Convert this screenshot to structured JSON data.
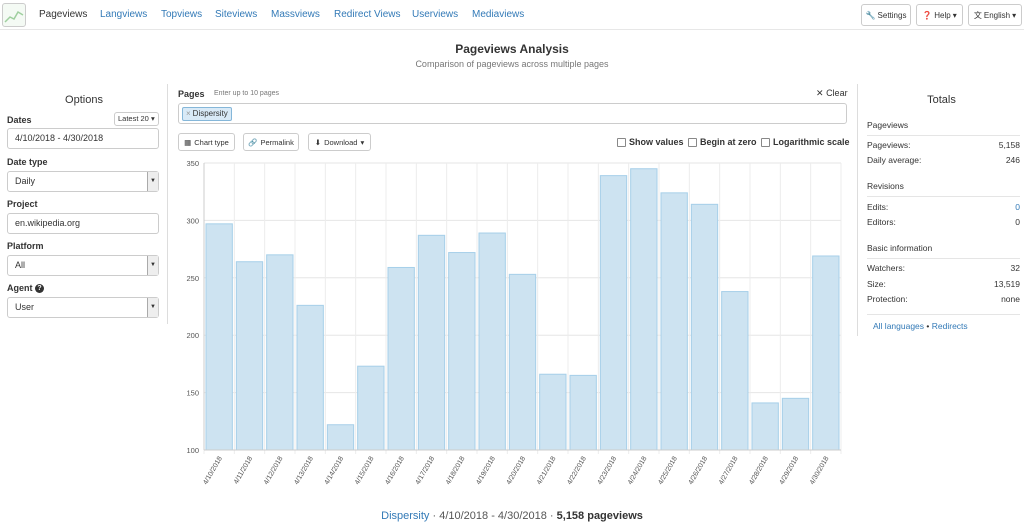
{
  "nav": {
    "tabs": [
      "Pageviews",
      "Langviews",
      "Topviews",
      "Siteviews",
      "Massviews",
      "Redirect Views",
      "Userviews",
      "Mediaviews"
    ],
    "settings_label": "Settings",
    "help_label": "Help",
    "language_label": "English"
  },
  "header": {
    "title": "Pageviews Analysis",
    "subtitle": "Comparison of pageviews across multiple pages"
  },
  "options": {
    "heading": "Options",
    "dates_label": "Dates",
    "latest_button": "Latest 20",
    "date_range": "4/10/2018 - 4/30/2018",
    "date_type_label": "Date type",
    "date_type_value": "Daily",
    "project_label": "Project",
    "project_value": "en.wikipedia.org",
    "platform_label": "Platform",
    "platform_value": "All",
    "agent_label": "Agent",
    "agent_value": "User"
  },
  "pages": {
    "label": "Pages",
    "hint": "Enter up to 10 pages",
    "clear_label": "Clear",
    "tag": "Dispersity"
  },
  "toolbar": {
    "chart_type": "Chart type",
    "permalink": "Permalink",
    "download": "Download",
    "show_values": "Show values",
    "begin_at_zero": "Begin at zero",
    "log_scale": "Logarithmic scale"
  },
  "chart_data": {
    "type": "bar",
    "categories": [
      "4/10/2018",
      "4/11/2018",
      "4/12/2018",
      "4/13/2018",
      "4/14/2018",
      "4/15/2018",
      "4/16/2018",
      "4/17/2018",
      "4/18/2018",
      "4/19/2018",
      "4/20/2018",
      "4/21/2018",
      "4/22/2018",
      "4/23/2018",
      "4/24/2018",
      "4/25/2018",
      "4/26/2018",
      "4/27/2018",
      "4/28/2018",
      "4/29/2018",
      "4/30/2018"
    ],
    "values": [
      297,
      264,
      270,
      226,
      122,
      173,
      259,
      287,
      272,
      289,
      253,
      166,
      165,
      339,
      345,
      324,
      314,
      238,
      141,
      145,
      269
    ],
    "ylim": [
      100,
      350
    ],
    "yticks": [
      100,
      150,
      200,
      250,
      300,
      350
    ],
    "bar_color": "#cde3f1",
    "bar_border": "#a6cfe9"
  },
  "footer": {
    "page": "Dispersity",
    "range": "4/10/2018 - 4/30/2018",
    "total": "5,158 pageviews"
  },
  "totals": {
    "heading": "Totals",
    "pageviews_section": "Pageviews",
    "pageviews_label": "Pageviews:",
    "pageviews_value": "5,158",
    "daily_label": "Daily average:",
    "daily_value": "246",
    "revisions_section": "Revisions",
    "edits_label": "Edits:",
    "edits_value": "0",
    "editors_label": "Editors:",
    "editors_value": "0",
    "basic_section": "Basic information",
    "watchers_label": "Watchers:",
    "watchers_value": "32",
    "size_label": "Size:",
    "size_value": "13,519",
    "protection_label": "Protection:",
    "protection_value": "none",
    "all_languages": "All languages",
    "redirects": "Redirects"
  }
}
